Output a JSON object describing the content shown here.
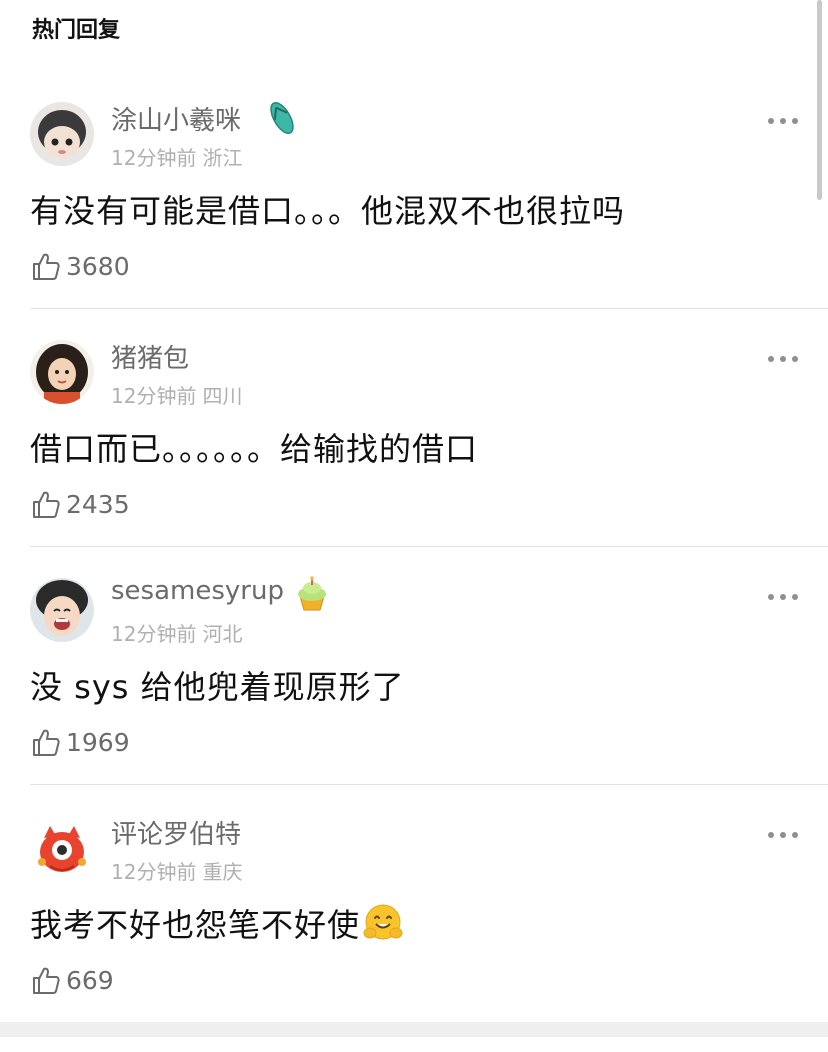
{
  "section": {
    "title": "热门回复"
  },
  "comments": [
    {
      "username": "涂山小羲咪",
      "badge_icon": "flip-flop-icon",
      "time": "12分钟前",
      "location": "浙江",
      "text": "有没有可能是借口。。。他混双不也很拉吗",
      "likes": "3680"
    },
    {
      "username": "猪猪包",
      "badge_icon": "",
      "time": "12分钟前",
      "location": "四川",
      "text": "借口而已。。。。。。给输找的借口",
      "likes": "2435"
    },
    {
      "username": "sesamesyrup",
      "badge_icon": "cupcake-icon",
      "time": "12分钟前",
      "location": "河北",
      "text": "没 sys 给他兜着现原形了",
      "likes": "1969"
    },
    {
      "username": "评论罗伯特",
      "badge_icon": "",
      "time": "12分钟前",
      "location": "重庆",
      "text": "我考不好也怨笔不好使",
      "text_emoji": "hugging-face-icon",
      "likes": "669"
    }
  ],
  "colors": {
    "username": "#6b6b6b",
    "meta": "#b0b0b0",
    "divider": "#e2e2e2",
    "body_text": "#111111"
  }
}
